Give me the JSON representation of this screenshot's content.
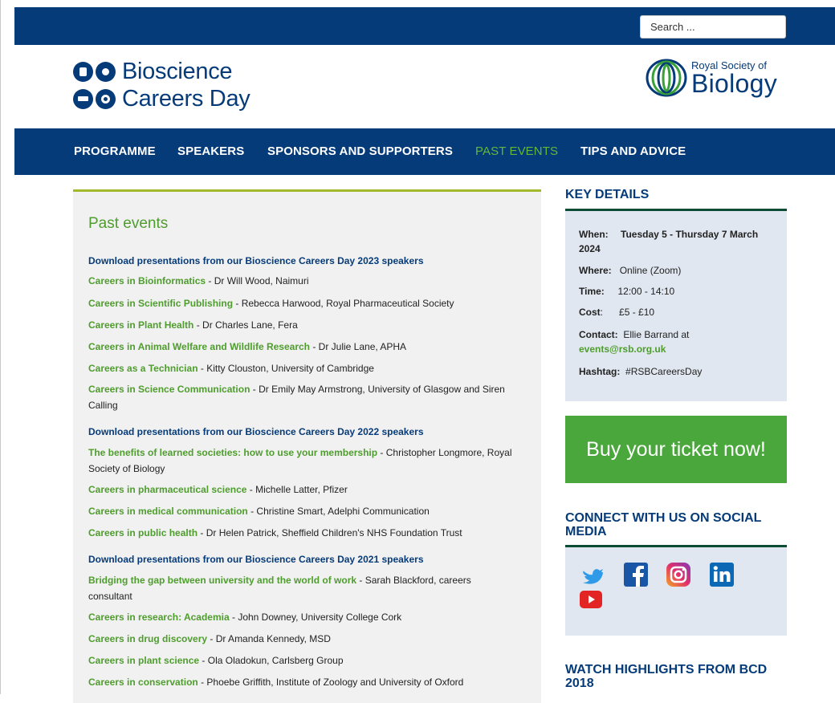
{
  "search": {
    "placeholder": "Search ..."
  },
  "brand": {
    "line1": "Bioscience",
    "line2": "Careers Day"
  },
  "rsb": {
    "small": "Royal Society of",
    "big": "Biology"
  },
  "nav": [
    "PROGRAMME",
    "SPEAKERS",
    "SPONSORS AND SUPPORTERS",
    "PAST EVENTS",
    "TIPS AND ADVICE"
  ],
  "main": {
    "title": "Past events",
    "sections": [
      {
        "heading": "Download presentations from our Bioscience Careers Day 2023 speakers",
        "items": [
          {
            "link": "Careers in Bioinformatics",
            "text": " - Dr Will Wood, Naimuri"
          },
          {
            "link": "Careers in Scientific Publishing",
            "text": " - Rebecca Harwood, Royal Pharmaceutical Society"
          },
          {
            "link": "Careers in Plant Health",
            "text": " - Dr Charles Lane, Fera"
          },
          {
            "link": "Careers in Animal Welfare and Wildlife Research",
            "text": " - Dr Julie Lane, APHA"
          },
          {
            "link": "Careers as a Technician",
            "text": " - Kitty Clouston, University of Cambridge"
          },
          {
            "link": "Careers in Science Communication",
            "text": " - Dr Emily May Armstrong, University of Glasgow and Siren Calling"
          }
        ]
      },
      {
        "heading": "Download presentations from our Bioscience Careers Day 2022 speakers",
        "items": [
          {
            "link": "The benefits of learned societies: how to use your membership",
            "text": " - Christopher Longmore, Royal Society of Biology"
          },
          {
            "link": "Careers in pharmaceutical science",
            "text": " - Michelle Latter, Pfizer"
          },
          {
            "link": "Careers in medical communication",
            "text": " - Christine Smart, Adelphi Communication"
          },
          {
            "link": "Careers in public health",
            "text": " -  Dr Helen Patrick, Sheffield Children's NHS Foundation Trust"
          }
        ]
      },
      {
        "heading": "Download presentations from our Bioscience Careers Day 2021 speakers",
        "items": [
          {
            "link": "Bridging the gap between university and the world of work",
            "text": " - Sarah Blackford, careers consultant"
          },
          {
            "link": "Careers in research: Academia",
            "text": " - John Downey, University College Cork"
          },
          {
            "link": "Careers in drug discovery",
            "text": " - Dr Amanda Kennedy, MSD"
          },
          {
            "link": "Careers in plant science",
            "text": " - Ola Oladokun, Carlsberg Group"
          },
          {
            "link": "Careers in conservation",
            "text": " - Phoebe Griffith, Institute of Zoology and University of Oxford"
          }
        ]
      }
    ]
  },
  "key_details": {
    "heading": "KEY DETAILS",
    "when_label": "When:",
    "when_value": "Tuesday 5 - Thursday 7 March 2024",
    "where_label": "Where:",
    "where_value": "Online (Zoom)",
    "time_label": "Time:",
    "time_value": "12:00 - 14:10",
    "cost_label": "Cost",
    "cost_value": "£5 - £10",
    "contact_label": "Contact:",
    "contact_value": "Ellie Barrand at",
    "contact_email": "events@rsb.org.uk",
    "hashtag_label": "Hashtag:",
    "hashtag_value": "#RSBCareersDay"
  },
  "buy": "Buy your ticket now!",
  "social": {
    "heading": "CONNECT WITH US ON SOCIAL MEDIA",
    "icons": [
      "twitter-icon",
      "facebook-icon",
      "instagram-icon",
      "linkedin-icon",
      "youtube-icon"
    ]
  },
  "watch": {
    "heading": "WATCH HIGHLIGHTS FROM BCD 2018"
  },
  "colors": {
    "navy": "#063b79",
    "green": "#4e9d2d",
    "accent_green": "#5fb83a",
    "olive": "#a2b92c",
    "panel": "#e1e7f0"
  }
}
